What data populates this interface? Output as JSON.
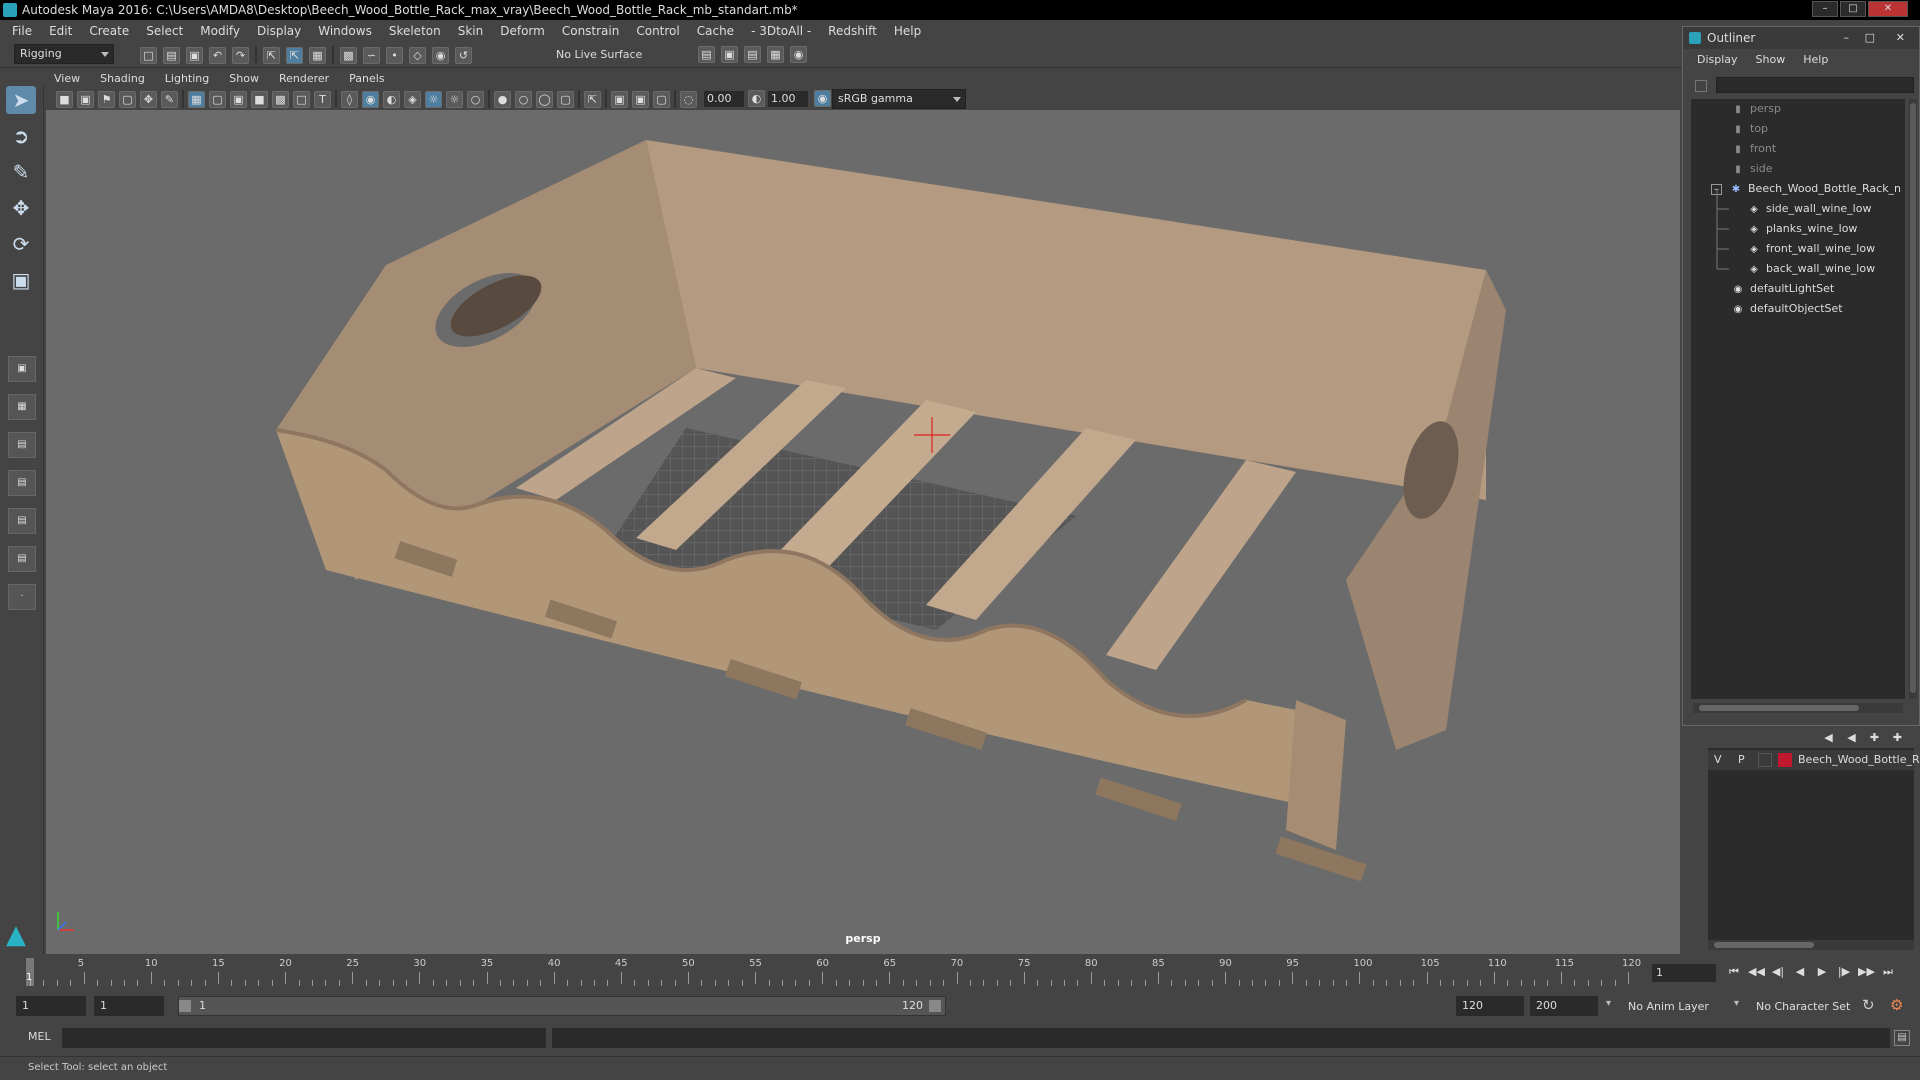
{
  "window": {
    "title": "Autodesk Maya 2016: C:\\Users\\AMDA8\\Desktop\\Beech_Wood_Bottle_Rack_max_vray\\Beech_Wood_Bottle_Rack_mb_standart.mb*"
  },
  "menu": [
    "File",
    "Edit",
    "Create",
    "Select",
    "Modify",
    "Display",
    "Windows",
    "Skeleton",
    "Skin",
    "Deform",
    "Constrain",
    "Control",
    "Cache",
    "- 3DtoAll -",
    "Redshift",
    "Help"
  ],
  "status": {
    "mode": "Rigging",
    "live_surface": "No Live Surface"
  },
  "viewport_menu": [
    "View",
    "Shading",
    "Lighting",
    "Show",
    "Renderer",
    "Panels"
  ],
  "viewport_toolbar": {
    "exposure": "0.00",
    "gamma": "1.00",
    "color_space": "sRGB gamma"
  },
  "viewport": {
    "camera_label": "persp"
  },
  "outliner": {
    "title": "Outliner",
    "menu": [
      "Display",
      "Show",
      "Help"
    ],
    "items": [
      {
        "label": "persp",
        "kind": "camera",
        "depth": 0,
        "dim": true
      },
      {
        "label": "top",
        "kind": "camera",
        "depth": 0,
        "dim": true
      },
      {
        "label": "front",
        "kind": "camera",
        "depth": 0,
        "dim": true
      },
      {
        "label": "side",
        "kind": "camera",
        "depth": 0,
        "dim": true
      },
      {
        "label": "Beech_Wood_Bottle_Rack_n",
        "kind": "group",
        "depth": 0,
        "dim": false,
        "expanded": true
      },
      {
        "label": "side_wall_wine_low",
        "kind": "mesh",
        "depth": 1,
        "dim": false
      },
      {
        "label": "planks_wine_low",
        "kind": "mesh",
        "depth": 1,
        "dim": false
      },
      {
        "label": "front_wall_wine_low",
        "kind": "mesh",
        "depth": 1,
        "dim": false
      },
      {
        "label": "back_wall_wine_low",
        "kind": "mesh",
        "depth": 1,
        "dim": false
      },
      {
        "label": "defaultLightSet",
        "kind": "set",
        "depth": 0,
        "dim": false
      },
      {
        "label": "defaultObjectSet",
        "kind": "set",
        "depth": 0,
        "dim": false
      }
    ]
  },
  "layers": {
    "rows": [
      {
        "v": "V",
        "p": "P",
        "color": "#c0182c",
        "name": "Beech_Wood_Bottle_R"
      }
    ]
  },
  "timeline": {
    "ticks": [
      "5",
      "10",
      "15",
      "20",
      "25",
      "30",
      "35",
      "40",
      "45",
      "50",
      "55",
      "60",
      "65",
      "70",
      "75",
      "80",
      "85",
      "90",
      "95",
      "100",
      "105",
      "110",
      "115",
      "120"
    ],
    "start_label": "1",
    "current_frame": "1"
  },
  "range": {
    "start": "1",
    "playback_start": "1",
    "slider_start": "1",
    "slider_end": "120",
    "playback_end": "120",
    "end": "200",
    "anim_layer": "No Anim Layer",
    "char_set": "No Character Set"
  },
  "command": {
    "lang": "MEL"
  },
  "help": {
    "text": "Select Tool: select an object"
  }
}
